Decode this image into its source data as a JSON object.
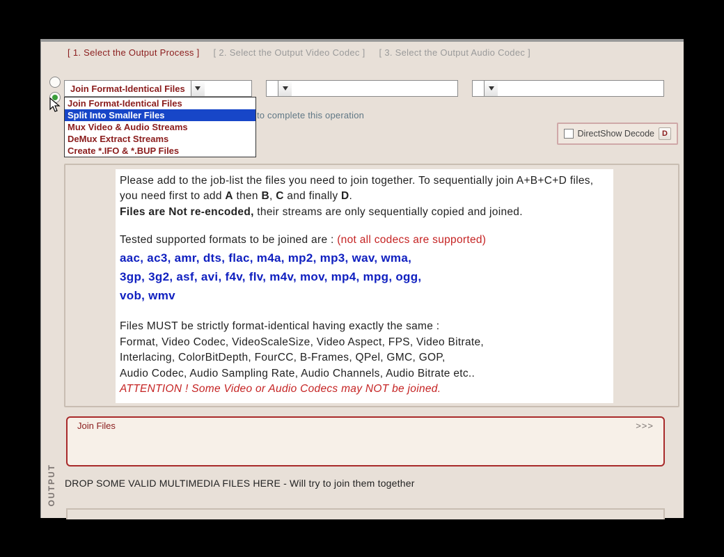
{
  "steps": {
    "s1": "[ 1.            Select the Output Process ]",
    "s2": "[ 2.        Select the Output Video Codec ]",
    "s3": "[ 3.        Select the Output Audio Codec ]"
  },
  "dropdown": {
    "selected": "Join Format-Identical Files",
    "videoCodec": "",
    "audioCodec": "",
    "options": [
      "Join Format-Identical Files",
      "Split Into Smaller Files",
      "Mux Video & Audio Streams",
      "DeMux Extract Streams",
      "Create *.IFO & *.BUP Files"
    ],
    "highlighted_index": 1
  },
  "status_fragment": "to complete this operation",
  "directshow": {
    "label": "DirectShow Decode",
    "btn": "D",
    "checked": false
  },
  "instructions": {
    "p1a": "Please add to the job-list the files you need to join together. To sequentially join A+B+C+D files, you need first to add ",
    "A": "A",
    "thenTxt": " then ",
    "B": "B",
    "comma": ", ",
    "C": "C",
    "finally": " and finally ",
    "D": "D",
    "dot": ".",
    "p2a": "Files are Not re-encoded,",
    "p2b": " their streams are only sequentially copied and joined.",
    "p3a": "Tested supported formats to be joined are : ",
    "p3b": "(not all codecs are supported)",
    "fmts1": "aac, ac3, amr, dts, flac, m4a, mp2, mp3, wav, wma,",
    "fmts2": "3gp, 3g2, asf, avi, f4v, flv, m4v, mov, mp4, mpg, ogg,",
    "fmts3": "vob, wmv",
    "p4": "Files MUST be strictly format-identical having exactly the same :",
    "p5": "Format, Video Codec, VideoScaleSize, Video Aspect, FPS, Video Bitrate,",
    "p6": "Interlacing, ColorBitDepth, FourCC, B-Frames, QPel, GMC, GOP,",
    "p7": "Audio Codec, Audio Sampling Rate, Audio Channels, Audio Bitrate etc..",
    "p8": "ATTENTION ! Some Video or Audio Codecs may NOT be joined."
  },
  "output": {
    "sidelabel": "OUTPUT",
    "title": "Join Files",
    "more": ">>>"
  },
  "drop_hint": "DROP SOME VALID MULTIMEDIA FILES HERE - Will try to join them together"
}
